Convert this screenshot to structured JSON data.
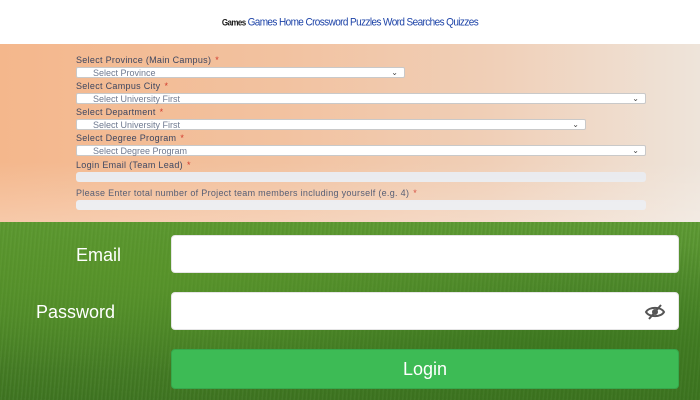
{
  "nav": {
    "brand": "Games",
    "links": [
      "Games",
      "Home",
      "Crossword",
      "Puzzles",
      "Word Searches",
      "Quizzes"
    ]
  },
  "registration": {
    "province_label": "Select Province (Main Campus)",
    "province_value": "Select Province",
    "campus_label": "Select Campus City",
    "campus_value": "Select University First",
    "department_label": "Select Department",
    "department_value": "Select University First",
    "degree_label": "Select Degree Program",
    "degree_value": "Select Degree Program",
    "email_label": "Login Email (Team Lead)",
    "members_label": "Please Enter total number of Project team members including yourself (e.g. 4)",
    "required_mark": "*"
  },
  "login": {
    "email_label": "Email",
    "password_label": "Password",
    "button_label": "Login",
    "password_toggle_icon": "eye-slash-icon"
  },
  "colors": {
    "login_button": "#3dbb55",
    "required": "#d23a2c",
    "nav_link": "#1e44a8"
  }
}
